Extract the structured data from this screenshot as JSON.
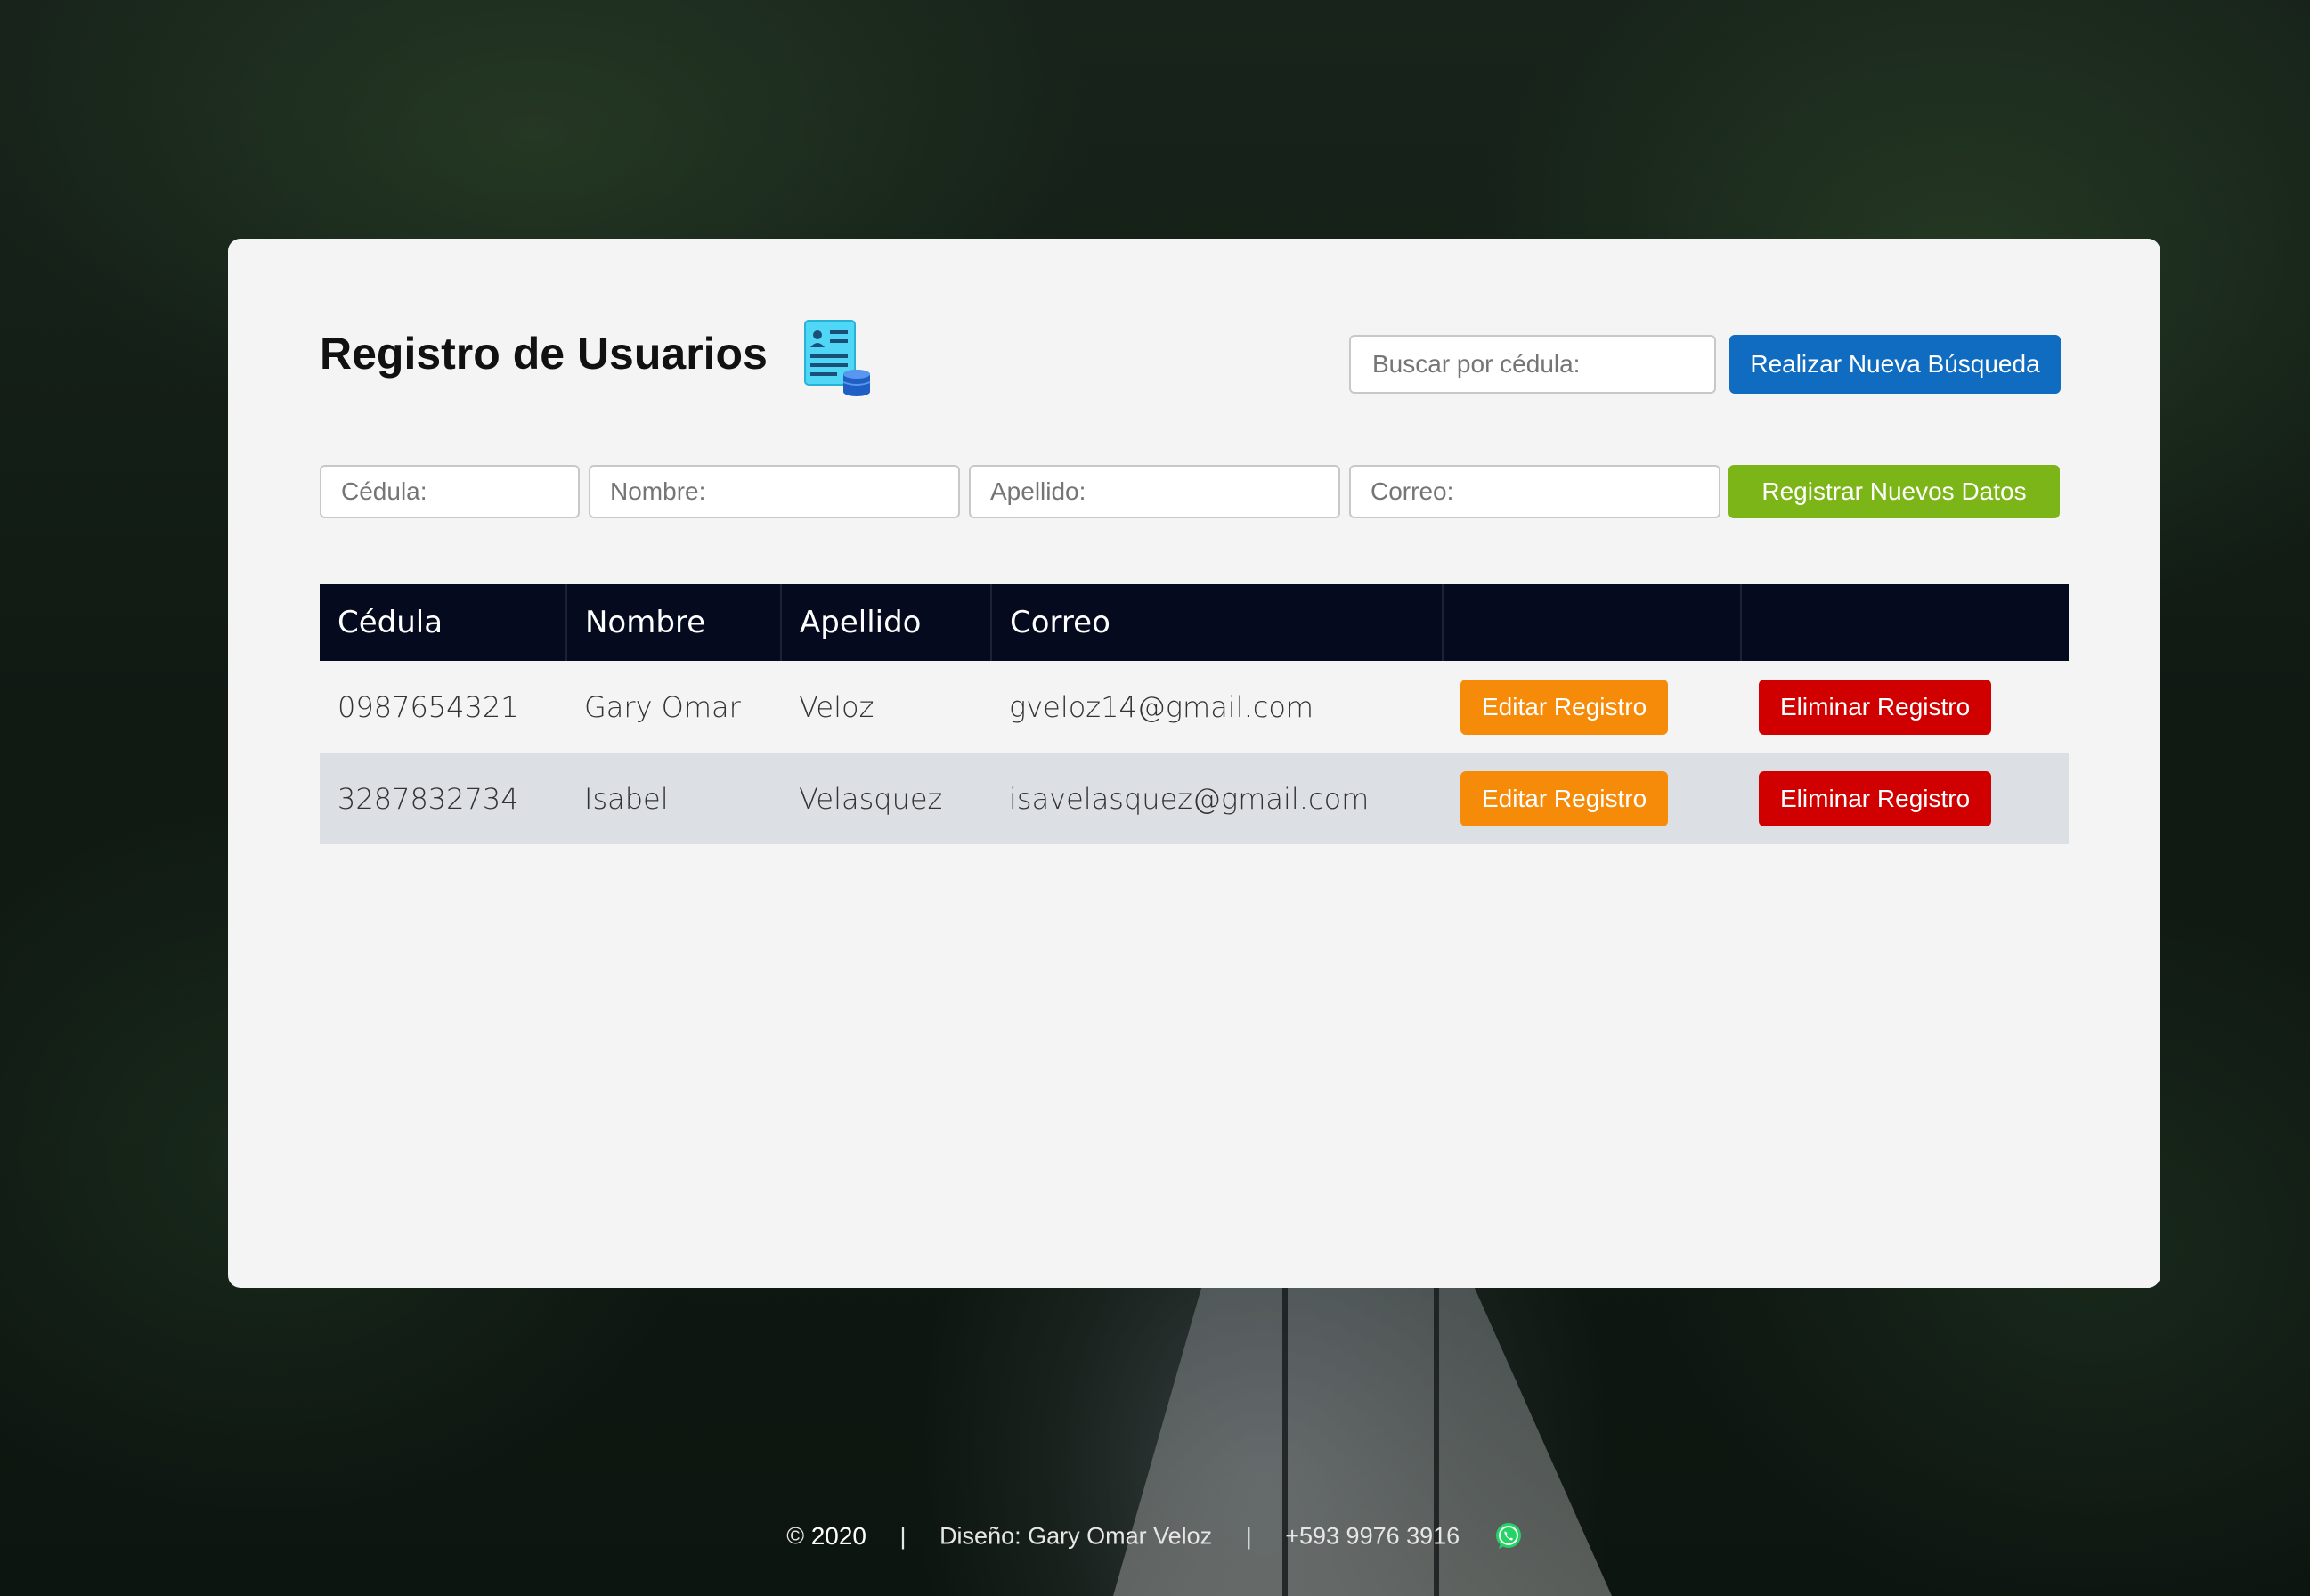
{
  "header": {
    "title": "Registro de Usuarios",
    "title_icon": "user-database-icon"
  },
  "search": {
    "placeholder": "Buscar por cédula:",
    "value": "",
    "button_label": "Realizar Nueva Búsqueda"
  },
  "form": {
    "cedula_placeholder": "Cédula:",
    "nombre_placeholder": "Nombre:",
    "apellido_placeholder": "Apellido:",
    "correo_placeholder": "Correo:",
    "register_label": "Registrar Nuevos Datos"
  },
  "table": {
    "columns": [
      "Cédula",
      "Nombre",
      "Apellido",
      "Correo",
      "",
      ""
    ],
    "rows": [
      {
        "cedula": "0987654321",
        "nombre": "Gary Omar",
        "apellido": "Veloz",
        "correo": "gveloz14@gmail.com",
        "edit_label": "Editar Registro",
        "delete_label": "Eliminar Registro"
      },
      {
        "cedula": "3287832734",
        "nombre": "Isabel",
        "apellido": "Velasquez",
        "correo": "isavelasquez@gmail.com",
        "edit_label": "Editar Registro",
        "delete_label": "Eliminar Registro"
      }
    ]
  },
  "footer": {
    "copyright_symbol": "©",
    "year": "2020",
    "separator": "|",
    "design": "Diseño: Gary Omar Veloz",
    "phone": "+593 9976 3916",
    "contact_icon": "whatsapp-icon"
  },
  "colors": {
    "primary_blue": "#0f6cc0",
    "register_green": "#7cb518",
    "edit_orange": "#f68b0a",
    "delete_red": "#d00000",
    "table_header": "#050a1e",
    "alt_row": "#dcdfe4",
    "card_background": "#f4f4f4"
  }
}
